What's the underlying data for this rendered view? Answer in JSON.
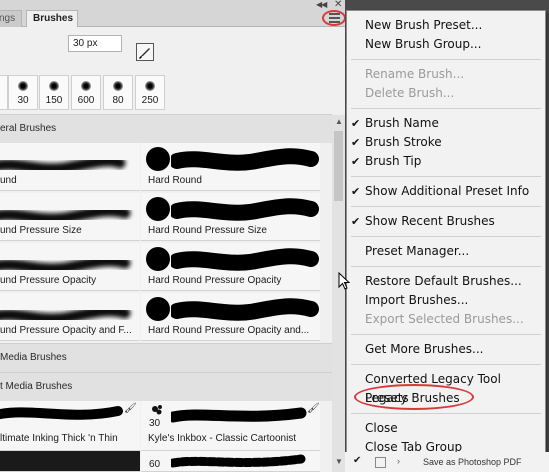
{
  "tabs": [
    {
      "label": "ngs"
    },
    {
      "label": "Brushes"
    }
  ],
  "size": {
    "value": "30 px"
  },
  "recent_brushes": [
    "30",
    "150",
    "600",
    "80",
    "250"
  ],
  "groups": {
    "general": "eral Brushes",
    "dry_media": " Media Brushes",
    "wet_media": "t Media Brushes"
  },
  "brushes": {
    "soft_round": "und",
    "hard_round": "Hard Round",
    "soft_round_pressure_size": "und Pressure Size",
    "hard_round_pressure_size": "Hard Round Pressure Size",
    "soft_round_pressure_opacity": "und Pressure Opacity",
    "hard_round_pressure_opacity": "Hard Round Pressure Opacity",
    "soft_round_pressure_opacity_flow": "und Pressure Opacity and F...",
    "hard_round_pressure_opacity_flow": "Hard Round Pressure Opacity and...",
    "kyle_thick_thin": "ltimate Inking Thick 'n Thin",
    "kyle_inkbox_size": "30",
    "kyle_inkbox": "Kyle's Inkbox - Classic Cartoonist",
    "next_size": "60"
  },
  "menu": {
    "new_brush_preset": "New Brush Preset...",
    "new_brush_group": "New Brush Group...",
    "rename_brush": "Rename Brush...",
    "delete_brush": "Delete Brush...",
    "brush_name": "Brush Name",
    "brush_stroke": "Brush Stroke",
    "brush_tip": "Brush Tip",
    "show_additional": "Show Additional Preset Info",
    "show_recent": "Show Recent Brushes",
    "preset_manager": "Preset Manager...",
    "restore_default": "Restore Default Brushes...",
    "import_brushes": "Import Brushes...",
    "export_selected": "Export Selected Brushes...",
    "get_more": "Get More Brushes...",
    "converted_legacy": "Converted Legacy Tool Presets",
    "legacy_brushes": "Legacy Brushes",
    "close": "Close",
    "close_tab_group": "Close Tab Group"
  },
  "bottom_strip": {
    "text": "Save as Photoshop PDF"
  },
  "colors": {
    "highlight_oval": "#d83a3a",
    "menu_bg": "#f2f2f2",
    "panel_bg": "#f0f0f0"
  }
}
